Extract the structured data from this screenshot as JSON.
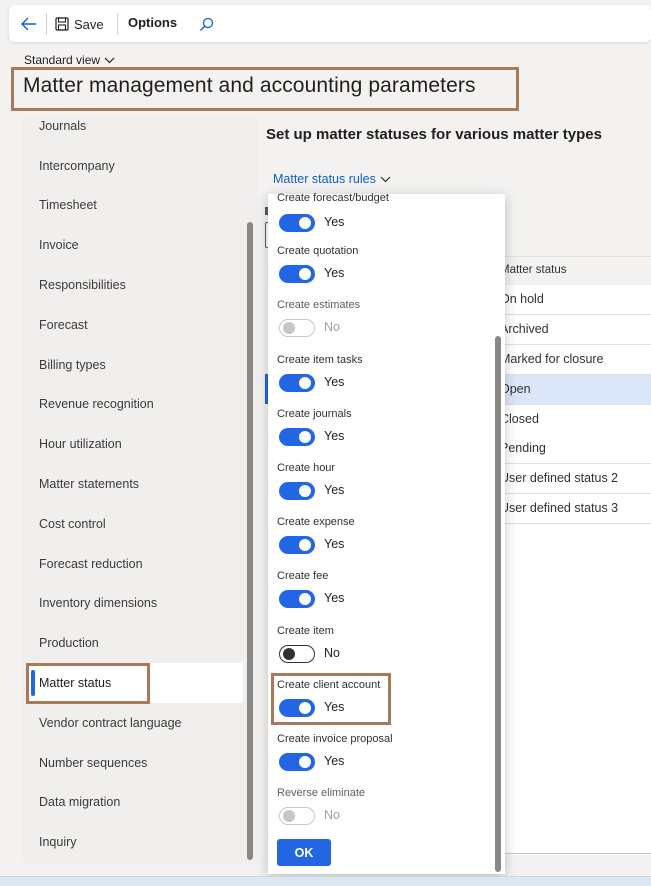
{
  "toolbar": {
    "save_label": "Save",
    "options_label": "Options"
  },
  "view": {
    "label": "Standard view"
  },
  "page": {
    "title": "Matter management and accounting parameters"
  },
  "nav": {
    "items": [
      "Journals",
      "Intercompany",
      "Timesheet",
      "Invoice",
      "Responsibilities",
      "Forecast",
      "Billing types",
      "Revenue recognition",
      "Hour utilization",
      "Matter statements",
      "Cost control",
      "Forecast reduction",
      "Inventory dimensions",
      "Production",
      "Matter status",
      "Vendor contract language",
      "Number sequences",
      "Data migration",
      "Inquiry"
    ],
    "active_index": 14
  },
  "main": {
    "title": "Set up matter statuses for various matter types",
    "tab_label": "Matter status rules",
    "grid": {
      "column_header": "Matter status",
      "rows": [
        "On hold",
        "Archived",
        "Marked for closure",
        "Open",
        "Closed",
        "Pending",
        "User defined status 2",
        "User defined status 3"
      ],
      "selected_index": 3
    }
  },
  "panel": {
    "fields": [
      {
        "label": "Create forecast/budget",
        "state": "on",
        "value": "Yes"
      },
      {
        "label": "Create quotation",
        "state": "on",
        "value": "Yes"
      },
      {
        "label": "Create estimates",
        "state": "disabled",
        "value": "No"
      },
      {
        "label": "Create item tasks",
        "state": "on",
        "value": "Yes"
      },
      {
        "label": "Create journals",
        "state": "on",
        "value": "Yes"
      },
      {
        "label": "Create hour",
        "state": "on",
        "value": "Yes"
      },
      {
        "label": "Create expense",
        "state": "on",
        "value": "Yes"
      },
      {
        "label": "Create fee",
        "state": "on",
        "value": "Yes"
      },
      {
        "label": "Create item",
        "state": "off",
        "value": "No"
      },
      {
        "label": "Create client account",
        "state": "on",
        "value": "Yes"
      },
      {
        "label": "Create invoice proposal",
        "state": "on",
        "value": "Yes"
      },
      {
        "label": "Reverse eliminate",
        "state": "disabled",
        "value": "No"
      }
    ],
    "ok_label": "OK"
  },
  "colors": {
    "accent": "#2266e3",
    "link": "#0f5ecb",
    "highlight_box": "#a87a5a",
    "selected_row": "#dbe7f8"
  }
}
